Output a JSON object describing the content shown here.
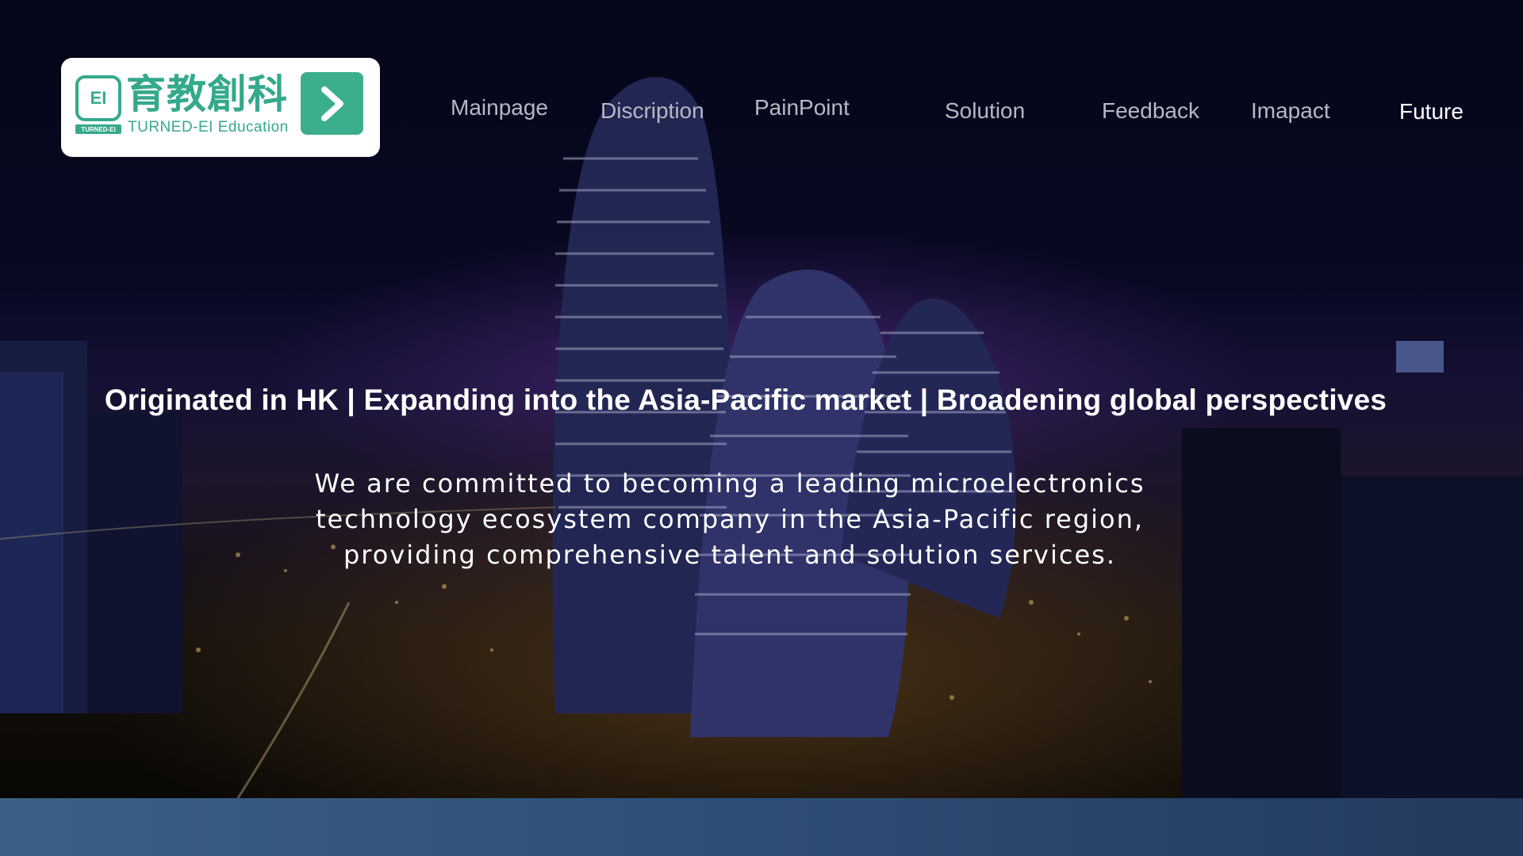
{
  "logo": {
    "chinese_name": "育教創科",
    "english_name": "TURNED-EI Education",
    "mark_text": "EI",
    "mark_sub_text": "TURNED-EI",
    "arrow_icon": "chevron-right-icon",
    "accent_color": "#35a98c"
  },
  "nav": {
    "items": [
      {
        "label": "Mainpage"
      },
      {
        "label": "Discription"
      },
      {
        "label": "PainPoint"
      },
      {
        "label": "Solution"
      },
      {
        "label": "Feedback"
      },
      {
        "label": "Imapact"
      },
      {
        "label": "Future"
      }
    ],
    "active": "Future"
  },
  "hero": {
    "headline": "Originated in HK | Expanding into the Asia-Pacific market | Broadening global perspectives",
    "body": "We are committed to becoming a leading microelectronics technology ecosystem company in the Asia-Pacific region, providing comprehensive talent and solution services."
  }
}
